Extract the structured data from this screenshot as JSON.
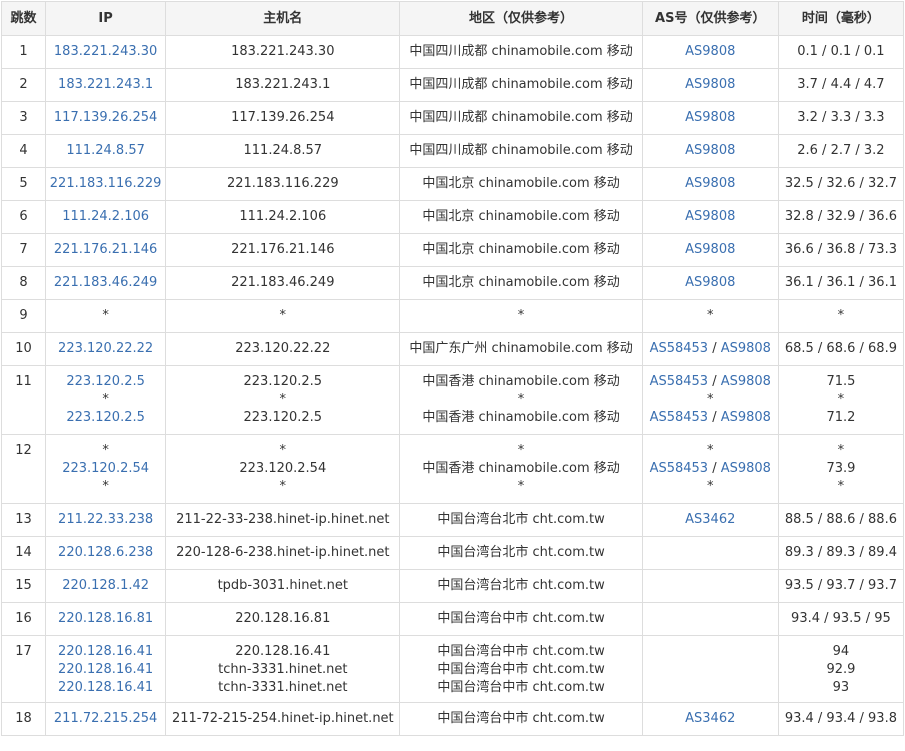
{
  "header": {
    "hop": "跳数",
    "ip": "IP",
    "host": "主机名",
    "region": "地区（仅供参考）",
    "asn": "AS号（仅供参考）",
    "time": "时间（毫秒）"
  },
  "rows": [
    {
      "hop": "1",
      "ip": [
        "183.221.243.30"
      ],
      "host": [
        "183.221.243.30"
      ],
      "region": [
        "中国四川成都 chinamobile.com 移动"
      ],
      "asn": [
        [
          "AS9808"
        ]
      ],
      "time": [
        "0.1 / 0.1 / 0.1"
      ]
    },
    {
      "hop": "2",
      "ip": [
        "183.221.243.1"
      ],
      "host": [
        "183.221.243.1"
      ],
      "region": [
        "中国四川成都 chinamobile.com 移动"
      ],
      "asn": [
        [
          "AS9808"
        ]
      ],
      "time": [
        "3.7 / 4.4 / 4.7"
      ]
    },
    {
      "hop": "3",
      "ip": [
        "117.139.26.254"
      ],
      "host": [
        "117.139.26.254"
      ],
      "region": [
        "中国四川成都 chinamobile.com 移动"
      ],
      "asn": [
        [
          "AS9808"
        ]
      ],
      "time": [
        "3.2 / 3.3 / 3.3"
      ]
    },
    {
      "hop": "4",
      "ip": [
        "111.24.8.57"
      ],
      "host": [
        "111.24.8.57"
      ],
      "region": [
        "中国四川成都 chinamobile.com 移动"
      ],
      "asn": [
        [
          "AS9808"
        ]
      ],
      "time": [
        "2.6 / 2.7 / 3.2"
      ]
    },
    {
      "hop": "5",
      "ip": [
        "221.183.116.229"
      ],
      "host": [
        "221.183.116.229"
      ],
      "region": [
        "中国北京 chinamobile.com 移动"
      ],
      "asn": [
        [
          "AS9808"
        ]
      ],
      "time": [
        "32.5 / 32.6 / 32.7"
      ]
    },
    {
      "hop": "6",
      "ip": [
        "111.24.2.106"
      ],
      "host": [
        "111.24.2.106"
      ],
      "region": [
        "中国北京 chinamobile.com 移动"
      ],
      "asn": [
        [
          "AS9808"
        ]
      ],
      "time": [
        "32.8 / 32.9 / 36.6"
      ]
    },
    {
      "hop": "7",
      "ip": [
        "221.176.21.146"
      ],
      "host": [
        "221.176.21.146"
      ],
      "region": [
        "中国北京 chinamobile.com 移动"
      ],
      "asn": [
        [
          "AS9808"
        ]
      ],
      "time": [
        "36.6 / 36.8 / 73.3"
      ]
    },
    {
      "hop": "8",
      "ip": [
        "221.183.46.249"
      ],
      "host": [
        "221.183.46.249"
      ],
      "region": [
        "中国北京 chinamobile.com 移动"
      ],
      "asn": [
        [
          "AS9808"
        ]
      ],
      "time": [
        "36.1 / 36.1 / 36.1"
      ]
    },
    {
      "hop": "9",
      "ip": [
        "*"
      ],
      "host": [
        "*"
      ],
      "region": [
        "*"
      ],
      "asn": [
        [
          "*"
        ]
      ],
      "time": [
        "*"
      ]
    },
    {
      "hop": "10",
      "ip": [
        "223.120.22.22"
      ],
      "host": [
        "223.120.22.22"
      ],
      "region": [
        "中国广东广州 chinamobile.com 移动"
      ],
      "asn": [
        [
          "AS58453",
          "AS9808"
        ]
      ],
      "time": [
        "68.5 / 68.6 / 68.9"
      ]
    },
    {
      "hop": "11",
      "ip": [
        "223.120.2.5",
        "*",
        "223.120.2.5"
      ],
      "host": [
        "223.120.2.5",
        "*",
        "223.120.2.5"
      ],
      "region": [
        "中国香港 chinamobile.com 移动",
        "*",
        "中国香港 chinamobile.com 移动"
      ],
      "asn": [
        [
          "AS58453",
          "AS9808"
        ],
        [
          "*"
        ],
        [
          "AS58453",
          "AS9808"
        ]
      ],
      "time": [
        "71.5",
        "*",
        "71.2"
      ]
    },
    {
      "hop": "12",
      "ip": [
        "*",
        "223.120.2.54",
        "*"
      ],
      "host": [
        "*",
        "223.120.2.54",
        "*"
      ],
      "region": [
        "*",
        "中国香港 chinamobile.com 移动",
        "*"
      ],
      "asn": [
        [
          "*"
        ],
        [
          "AS58453",
          "AS9808"
        ],
        [
          "*"
        ]
      ],
      "time": [
        "*",
        "73.9",
        "*"
      ]
    },
    {
      "hop": "13",
      "ip": [
        "211.22.33.238"
      ],
      "host": [
        "211-22-33-238.hinet-ip.hinet.net"
      ],
      "region": [
        "中国台湾台北市 cht.com.tw"
      ],
      "asn": [
        [
          "AS3462"
        ]
      ],
      "time": [
        "88.5 / 88.6 / 88.6"
      ]
    },
    {
      "hop": "14",
      "ip": [
        "220.128.6.238"
      ],
      "host": [
        "220-128-6-238.hinet-ip.hinet.net"
      ],
      "region": [
        "中国台湾台北市 cht.com.tw"
      ],
      "asn": [
        []
      ],
      "time": [
        "89.3 / 89.3 / 89.4"
      ]
    },
    {
      "hop": "15",
      "ip": [
        "220.128.1.42"
      ],
      "host": [
        "tpdb-3031.hinet.net"
      ],
      "region": [
        "中国台湾台北市 cht.com.tw"
      ],
      "asn": [
        []
      ],
      "time": [
        "93.5 / 93.7 / 93.7"
      ]
    },
    {
      "hop": "16",
      "ip": [
        "220.128.16.81"
      ],
      "host": [
        "220.128.16.81"
      ],
      "region": [
        "中国台湾台中市 cht.com.tw"
      ],
      "asn": [
        []
      ],
      "time": [
        "93.4 / 93.5 / 95"
      ]
    },
    {
      "hop": "17",
      "ip": [
        "220.128.16.41",
        "220.128.16.41",
        "220.128.16.41"
      ],
      "host": [
        "220.128.16.41",
        "tchn-3331.hinet.net",
        "tchn-3331.hinet.net"
      ],
      "region": [
        "中国台湾台中市 cht.com.tw",
        "中国台湾台中市 cht.com.tw",
        "中国台湾台中市 cht.com.tw"
      ],
      "asn": [
        [],
        [],
        []
      ],
      "time": [
        "94",
        "92.9",
        "93"
      ]
    },
    {
      "hop": "18",
      "ip": [
        "211.72.215.254"
      ],
      "host": [
        "211-72-215-254.hinet-ip.hinet.net"
      ],
      "region": [
        "中国台湾台中市 cht.com.tw"
      ],
      "asn": [
        [
          "AS3462"
        ]
      ],
      "time": [
        "93.4 / 93.4 / 93.8"
      ]
    }
  ],
  "colors": {
    "link": "#3a6fb0",
    "border": "#dddddd",
    "header_bg": "#f5f5f5"
  }
}
